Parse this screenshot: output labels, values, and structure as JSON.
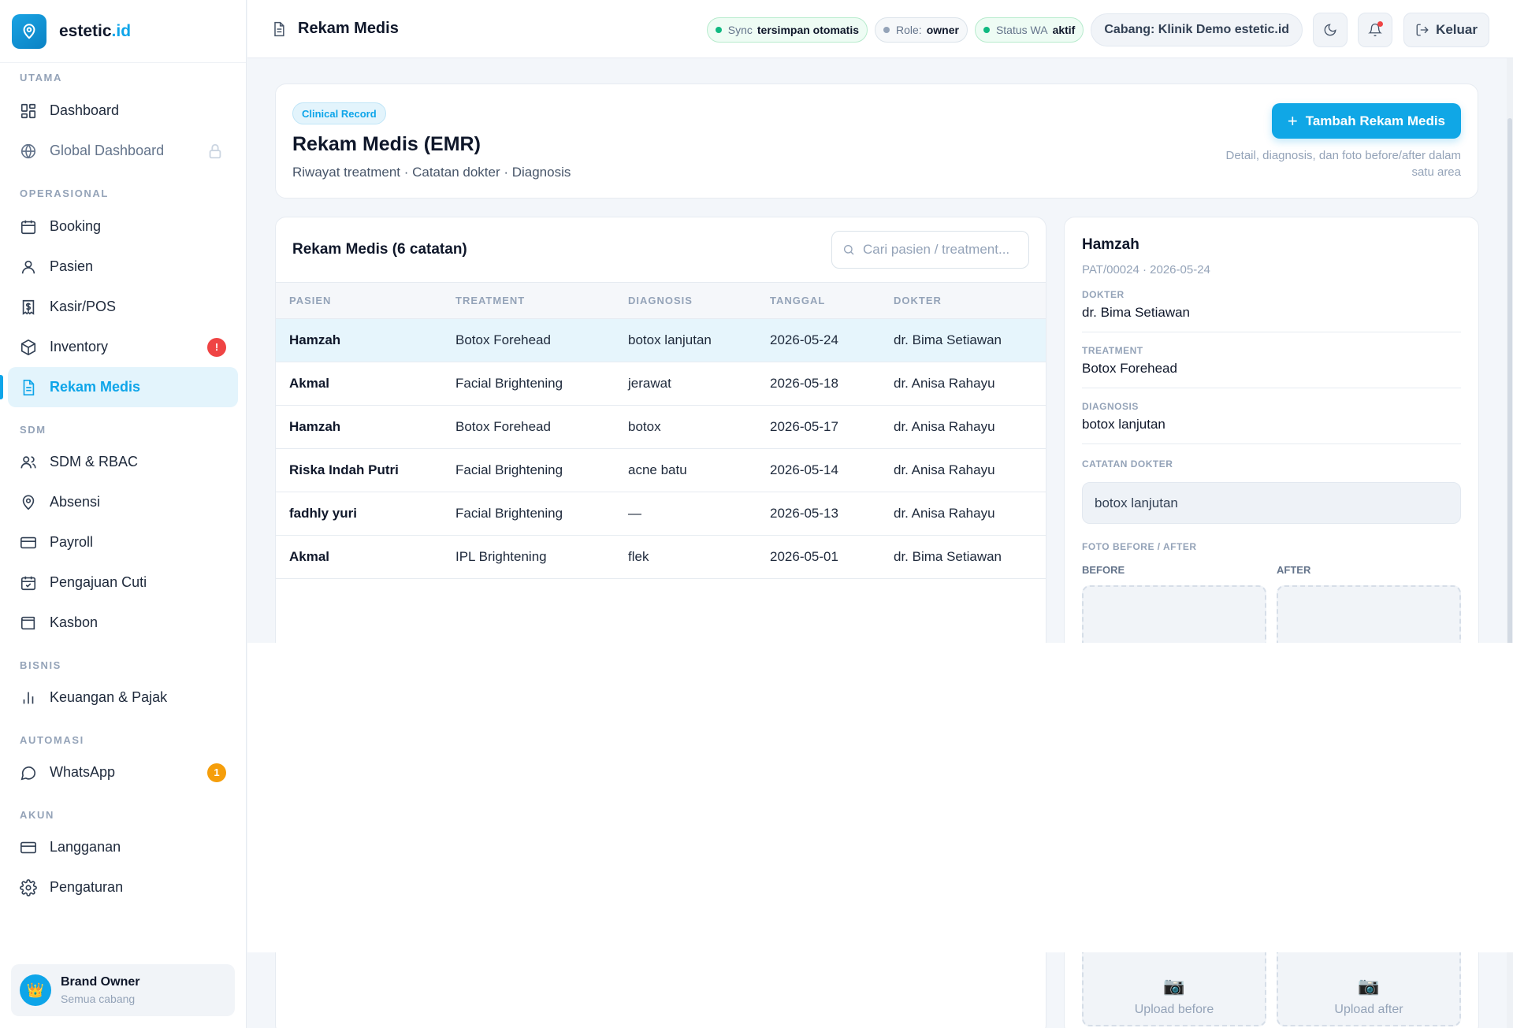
{
  "brand": {
    "name_main": "estetic",
    "name_accent": ".id",
    "logo_icon": "location-pin-icon"
  },
  "sidebar": {
    "sections": {
      "utama": "UTAMA",
      "operasional": "OPERASIONAL",
      "sdm": "SDM",
      "bisnis": "BISNIS",
      "automasi": "AUTOMASI",
      "akun": "AKUN"
    },
    "items": {
      "dashboard": "Dashboard",
      "global_dashboard": "Global Dashboard",
      "booking": "Booking",
      "pasien": "Pasien",
      "kasir": "Kasir/POS",
      "inventory": "Inventory",
      "inventory_badge": "!",
      "rekam_medis": "Rekam Medis",
      "sdm_rbac": "SDM & RBAC",
      "absensi": "Absensi",
      "payroll": "Payroll",
      "pengajuan_cuti": "Pengajuan Cuti",
      "kasbon": "Kasbon",
      "keuangan": "Keuangan & Pajak",
      "whatsapp": "WhatsApp",
      "whatsapp_badge": "1",
      "langganan": "Langganan",
      "pengaturan": "Pengaturan"
    },
    "user": {
      "name": "Brand Owner",
      "sub": "Semua cabang",
      "avatar": "👑"
    }
  },
  "topbar": {
    "title": "Rekam Medis",
    "sync_label": "Sync",
    "sync_value": "tersimpan otomatis",
    "role_label": "Role:",
    "role_value": "owner",
    "wa_label": "Status WA",
    "wa_value": "aktif",
    "branch": "Cabang: Klinik Demo estetic.id",
    "logout": "Keluar"
  },
  "header": {
    "tag": "Clinical Record",
    "title": "Rekam Medis (EMR)",
    "subtitle": "Riwayat treatment · Catatan dokter · Diagnosis",
    "add_button": "Tambah Rekam Medis",
    "note": "Detail, diagnosis, dan foto before/after dalam satu area"
  },
  "list": {
    "title": "Rekam Medis (6 catatan)",
    "search_placeholder": "Cari pasien / treatment...",
    "columns": [
      "PASIEN",
      "TREATMENT",
      "DIAGNOSIS",
      "TANGGAL",
      "DOKTER"
    ],
    "rows": [
      [
        "Hamzah",
        "Botox Forehead",
        "botox lanjutan",
        "2026-05-24",
        "dr. Bima Setiawan"
      ],
      [
        "Akmal",
        "Facial Brightening",
        "jerawat",
        "2026-05-18",
        "dr. Anisa Rahayu"
      ],
      [
        "Hamzah",
        "Botox Forehead",
        "botox",
        "2026-05-17",
        "dr. Anisa Rahayu"
      ],
      [
        "Riska Indah Putri",
        "Facial Brightening",
        "acne batu",
        "2026-05-14",
        "dr. Anisa Rahayu"
      ],
      [
        "fadhly yuri",
        "Facial Brightening",
        "—",
        "2026-05-13",
        "dr. Anisa Rahayu"
      ],
      [
        "Akmal",
        "IPL Brightening",
        "flek",
        "2026-05-01",
        "dr. Bima Setiawan"
      ]
    ]
  },
  "detail": {
    "name": "Hamzah",
    "sub": "PAT/00024 · 2026-05-24",
    "dokter_label": "DOKTER",
    "dokter": "dr. Bima Setiawan",
    "treatment_label": "TREATMENT",
    "treatment": "Botox Forehead",
    "diagnosis_label": "DIAGNOSIS",
    "diagnosis": "botox lanjutan",
    "catatan_label": "CATATAN DOKTER",
    "catatan": "botox lanjutan",
    "photo_label": "FOTO BEFORE / AFTER",
    "before_label": "BEFORE",
    "after_label": "AFTER",
    "upload_before": "Upload before",
    "upload_after": "Upload after"
  },
  "colors": {
    "accent": "#0ea5e9",
    "danger": "#ef4444",
    "warning": "#f59e0b",
    "success": "#10b981"
  }
}
